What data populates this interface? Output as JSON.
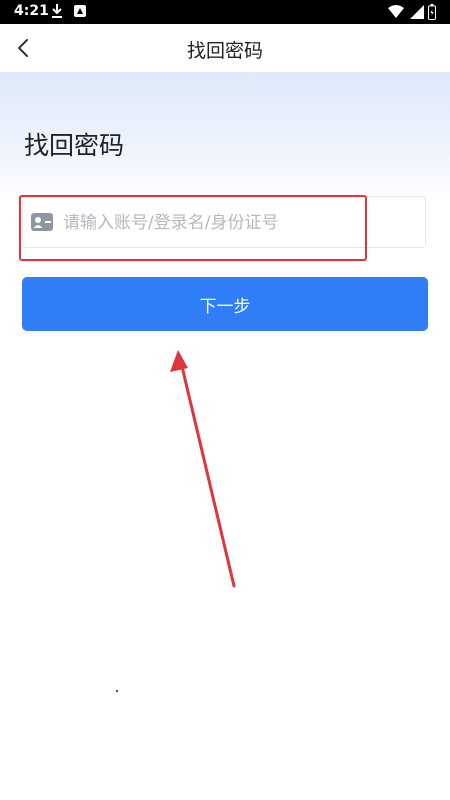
{
  "status_bar": {
    "time": "4:21",
    "icons": [
      "download-icon",
      "app-notification-icon",
      "wifi-icon",
      "signal-icon",
      "battery-icon"
    ]
  },
  "nav": {
    "back_icon": "chevron-left-icon",
    "title": "找回密码"
  },
  "page": {
    "heading": "找回密码"
  },
  "account_field": {
    "icon": "user-card-icon",
    "value": "",
    "placeholder": "请输入账号/登录名/身份证号"
  },
  "next_button": {
    "label": "下一步"
  },
  "colors": {
    "primary": "#2f7ef8",
    "annotation": "#e0353a",
    "hero_gradient_top": "#dfe9fb"
  }
}
